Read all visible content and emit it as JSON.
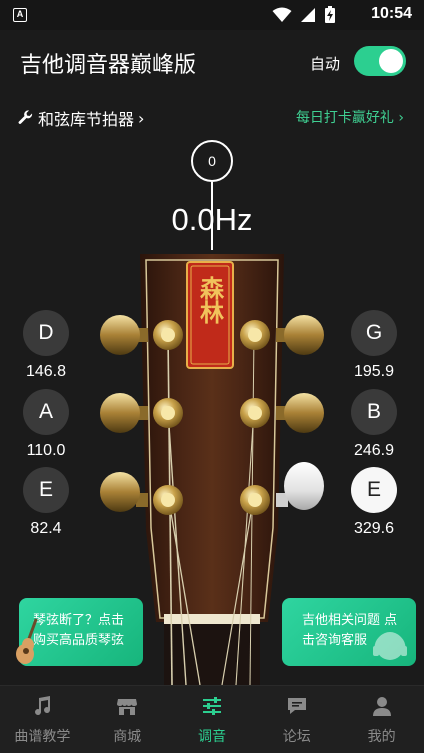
{
  "status_bar": {
    "time": "10:54",
    "badge": "A"
  },
  "header": {
    "title": "吉他调音器巅峰版",
    "auto_label": "自动",
    "auto_enabled": true
  },
  "subbar": {
    "chord_link": "和弦库节拍器",
    "daily_link": "每日打卡赢好礼"
  },
  "tuner": {
    "needle_value": "0",
    "frequency": "0.0Hz",
    "strings": [
      {
        "note": "D",
        "freq": "146.8",
        "side": "left"
      },
      {
        "note": "A",
        "freq": "110.0",
        "side": "left"
      },
      {
        "note": "E",
        "freq": "82.4",
        "side": "left"
      },
      {
        "note": "G",
        "freq": "195.9",
        "side": "right"
      },
      {
        "note": "B",
        "freq": "246.9",
        "side": "right"
      },
      {
        "note": "E",
        "freq": "329.6",
        "side": "right"
      }
    ],
    "selected_string": "E-329.6",
    "logo_text": "森林"
  },
  "promos": {
    "left_line1": "琴弦断了？点击",
    "left_line2": "购买高品质琴弦",
    "right_line1": "吉他相关问题 点",
    "right_line2": "击咨询客服"
  },
  "tabs": [
    {
      "label": "曲谱教学",
      "icon": "music-note-icon",
      "active": false
    },
    {
      "label": "商城",
      "icon": "store-icon",
      "active": false
    },
    {
      "label": "调音",
      "icon": "tuner-sliders-icon",
      "active": true
    },
    {
      "label": "论坛",
      "icon": "forum-icon",
      "active": false
    },
    {
      "label": "我的",
      "icon": "profile-icon",
      "active": false
    }
  ],
  "colors": {
    "accent": "#2ccf90",
    "background": "#1b1b1b",
    "tab_bar": "#202020"
  }
}
